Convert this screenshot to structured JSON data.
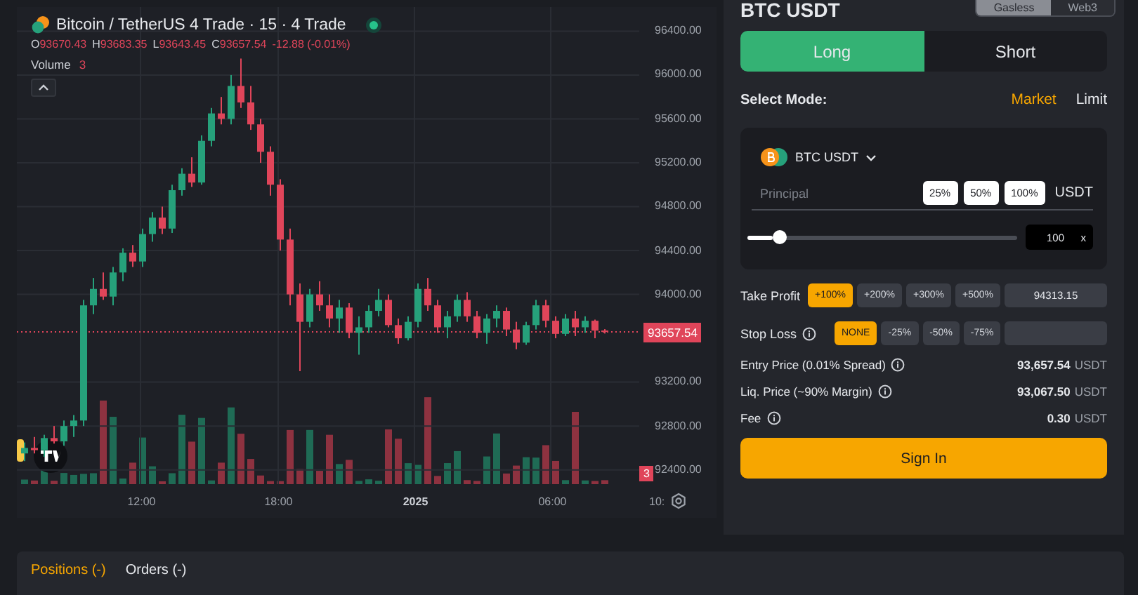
{
  "chart": {
    "title": "Bitcoin / TetherUS 4 Trade · 15 · 4 Trade",
    "ohlc": [
      {
        "label": "O",
        "value": "93670.43"
      },
      {
        "label": "H",
        "value": "93683.35"
      },
      {
        "label": "L",
        "value": "93643.45"
      },
      {
        "label": "C",
        "value": "93657.54"
      }
    ],
    "change": "-12.88 (-0.01%)",
    "volume": {
      "label": "Volume",
      "value": "3"
    },
    "volume_tag": "3",
    "chart_data": {
      "type": "candlestick",
      "ylim": [
        92270,
        96620
      ],
      "grid": true,
      "ref_lines": [
        {
          "axis": "y",
          "value": 93657.54,
          "label": "93657.54"
        }
      ],
      "categories": [
        null,
        null,
        null,
        null,
        null,
        null,
        null,
        null,
        null,
        null,
        null,
        null,
        null,
        null,
        null,
        null,
        null,
        null,
        null,
        null,
        null,
        null,
        null,
        null,
        null,
        null,
        null,
        null,
        null,
        null,
        null,
        null,
        null,
        null,
        null,
        null,
        null,
        null,
        null,
        null,
        null,
        null,
        null,
        null,
        null,
        null,
        null,
        null,
        null,
        null,
        null,
        null,
        null,
        null,
        null,
        null,
        null,
        null,
        null,
        null
      ],
      "ohlc": [
        [
          92550,
          92650,
          92480,
          92600
        ],
        [
          92600,
          92700,
          92550,
          92580
        ],
        [
          92580,
          92720,
          92520,
          92690
        ],
        [
          92690,
          92800,
          92640,
          92660
        ],
        [
          92660,
          92850,
          92620,
          92800
        ],
        [
          92800,
          92900,
          92700,
          92850
        ],
        [
          92850,
          93950,
          92800,
          93900
        ],
        [
          93900,
          94150,
          93820,
          94050
        ],
        [
          94050,
          94200,
          93950,
          93980
        ],
        [
          93980,
          94250,
          93900,
          94200
        ],
        [
          94200,
          94420,
          94120,
          94380
        ],
        [
          94380,
          94450,
          94250,
          94300
        ],
        [
          94300,
          94600,
          94250,
          94550
        ],
        [
          94550,
          94750,
          94480,
          94700
        ],
        [
          94700,
          94800,
          94550,
          94600
        ],
        [
          94600,
          95000,
          94560,
          94950
        ],
        [
          94950,
          95150,
          94900,
          95100
        ],
        [
          95100,
          95250,
          94980,
          95020
        ],
        [
          95020,
          95450,
          95000,
          95400
        ],
        [
          95400,
          95700,
          95350,
          95650
        ],
        [
          95650,
          95800,
          95550,
          95600
        ],
        [
          95600,
          96000,
          95550,
          95900
        ],
        [
          95900,
          96150,
          95700,
          95750
        ],
        [
          95750,
          95900,
          95500,
          95550
        ],
        [
          95550,
          95600,
          95200,
          95300
        ],
        [
          95300,
          95350,
          94900,
          95000
        ],
        [
          95000,
          95050,
          94400,
          94500
        ],
        [
          94500,
          94600,
          93900,
          94000
        ],
        [
          94000,
          94100,
          93300,
          93750
        ],
        [
          93750,
          94050,
          93700,
          94000
        ],
        [
          94000,
          94120,
          93850,
          93900
        ],
        [
          93900,
          94000,
          93700,
          93780
        ],
        [
          93780,
          93950,
          93650,
          93880
        ],
        [
          93880,
          93920,
          93600,
          93650
        ],
        [
          93650,
          93800,
          93450,
          93700
        ],
        [
          93700,
          93900,
          93650,
          93850
        ],
        [
          93850,
          94050,
          93800,
          93950
        ],
        [
          93950,
          94000,
          93700,
          93720
        ],
        [
          93720,
          93780,
          93550,
          93600
        ],
        [
          93600,
          93800,
          93580,
          93750
        ],
        [
          93750,
          94100,
          93700,
          94050
        ],
        [
          94050,
          94150,
          93850,
          93900
        ],
        [
          93900,
          93950,
          93650,
          93700
        ],
        [
          93700,
          93850,
          93600,
          93800
        ],
        [
          93800,
          94000,
          93750,
          93950
        ],
        [
          93950,
          94020,
          93750,
          93800
        ],
        [
          93800,
          93850,
          93600,
          93650
        ],
        [
          93650,
          93820,
          93550,
          93780
        ],
        [
          93780,
          93900,
          93700,
          93850
        ],
        [
          93850,
          93880,
          93620,
          93680
        ],
        [
          93680,
          93750,
          93500,
          93560
        ],
        [
          93560,
          93750,
          93540,
          93720
        ],
        [
          93720,
          93950,
          93680,
          93900
        ],
        [
          93900,
          93950,
          93700,
          93760
        ],
        [
          93760,
          93800,
          93600,
          93640
        ],
        [
          93640,
          93820,
          93620,
          93780
        ],
        [
          93780,
          93850,
          93620,
          93700
        ],
        [
          93700,
          93800,
          93650,
          93760
        ],
        [
          93760,
          93770,
          93600,
          93670
        ],
        [
          93670.43,
          93683.35,
          93643.45,
          93657.54
        ]
      ],
      "yticks": [
        {
          "value": 96400,
          "label": "96400.00"
        },
        {
          "value": 96000,
          "label": "96000.00"
        },
        {
          "value": 95600,
          "label": "95600.00"
        },
        {
          "value": 95200,
          "label": "95200.00"
        },
        {
          "value": 94800,
          "label": "94800.00"
        },
        {
          "value": 94400,
          "label": "94400.00"
        },
        {
          "value": 94000,
          "label": "94000.00"
        },
        {
          "value": 93200,
          "label": "93200.00"
        },
        {
          "value": 92800,
          "label": "92800.00"
        },
        {
          "value": 92400,
          "label": "92400.00"
        }
      ]
    },
    "time_axis": [
      {
        "label": "12:00",
        "bold": false
      },
      {
        "label": "18:00",
        "bold": false
      },
      {
        "label": "2025",
        "bold": true
      },
      {
        "label": "06:00",
        "bold": false
      },
      {
        "label": "10:",
        "bold": false
      }
    ]
  },
  "trade": {
    "pair": "BTC USDT",
    "wallet_toggle": [
      {
        "label": "Gasless",
        "selected": true
      },
      {
        "label": "Web3",
        "selected": false
      }
    ],
    "sides": [
      {
        "label": "Long",
        "selected": true
      },
      {
        "label": "Short",
        "selected": false
      }
    ],
    "mode_label": "Select Mode:",
    "modes": [
      {
        "label": "Market",
        "selected": true
      },
      {
        "label": "Limit",
        "selected": false
      }
    ],
    "asset": "BTC USDT",
    "principal": {
      "placeholder": "Principal",
      "presets": [
        "25%",
        "50%",
        "100%"
      ],
      "currency": "USDT"
    },
    "leverage": {
      "level": 0.12,
      "value": "100",
      "unit": "x"
    },
    "take_profit": {
      "label": "Take Profit",
      "info": false,
      "options": [
        {
          "label": "+100%",
          "selected": true
        },
        {
          "label": "+200%",
          "selected": false
        },
        {
          "label": "+300%",
          "selected": false
        },
        {
          "label": "+500%",
          "selected": false
        }
      ],
      "value": "94313.15"
    },
    "stop_loss": {
      "label": "Stop Loss",
      "info": true,
      "options": [
        {
          "label": "NONE",
          "selected": true
        },
        {
          "label": "-25%",
          "selected": false
        },
        {
          "label": "-50%",
          "selected": false
        },
        {
          "label": "-75%",
          "selected": false
        }
      ]
    },
    "info_rows": [
      {
        "label": "Entry Price (0.01% Spread)",
        "value": "93,657.54",
        "unit": "USDT"
      },
      {
        "label": "Liq. Price (~90% Margin)",
        "value": "93,067.50",
        "unit": "USDT"
      },
      {
        "label": "Fee",
        "value": "0.30",
        "unit": "USDT"
      }
    ],
    "submit": "Sign In"
  },
  "bottom_tabs": [
    {
      "label": "Positions (-)",
      "selected": true
    },
    {
      "label": "Orders (-)",
      "selected": false
    }
  ]
}
